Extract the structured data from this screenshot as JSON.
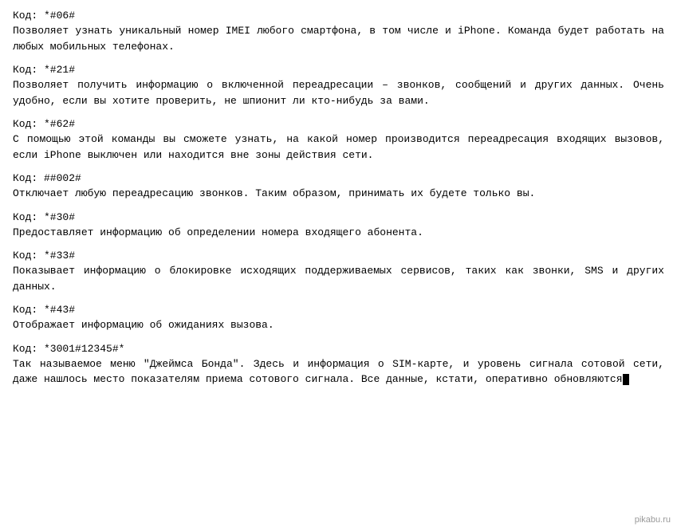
{
  "blocks": [
    {
      "code": "Код: *#06#",
      "description": "Позволяет узнать уникальный номер IMEI любого смартфона, в том числе и iPhone. Команда будет работать на любых мобильных телефонах."
    },
    {
      "code": "Код: *#21#",
      "description": "Позволяет получить информацию о включенной переадресации – звонков, сообщений и других данных. Очень удобно, если вы хотите проверить, не шпионит ли кто-нибудь за вами."
    },
    {
      "code": "Код: *#62#",
      "description": "С помощью этой команды вы сможете узнать, на какой номер производится переадресация входящих вызовов, если iPhone выключен или находится вне зоны действия сети."
    },
    {
      "code": "Код: ##002#",
      "description": "Отключает любую переадресацию звонков. Таким образом, принимать их будете только вы."
    },
    {
      "code": "Код: *#30#",
      "description": "Предоставляет информацию об определении номера входящего абонента."
    },
    {
      "code": "Код: *#33#",
      "description": "Показывает информацию о блокировке исходящих поддерживаемых сервисов, таких как звонки, SMS и других данных."
    },
    {
      "code": "Код: *#43#",
      "description": "Отображает информацию об ожиданиях вызова."
    },
    {
      "code": "Код: *3001#12345#*",
      "description": "Так называемое меню \"Джеймса Бонда\". Здесь и информация о SIM-карте, и уровень сигнала сотовой сети, даже нашлось место показателям приема сотового сигнала. Все данные, кстати, оперативно обновляются"
    }
  ],
  "watermark": "pikabu.ru"
}
